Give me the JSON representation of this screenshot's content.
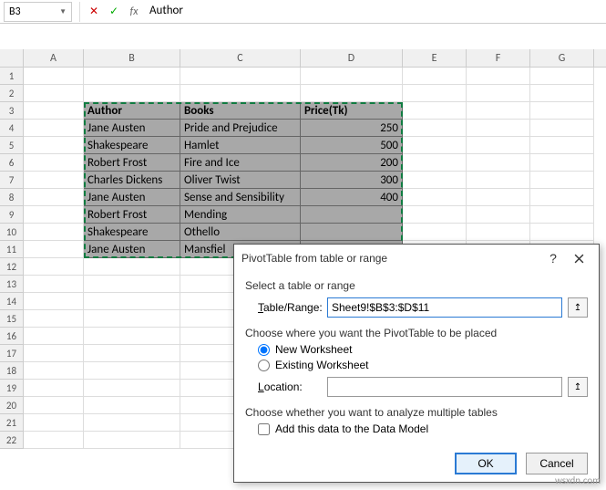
{
  "nameBox": {
    "value": "B3"
  },
  "formulaBar": {
    "value": "Author"
  },
  "cols": [
    "A",
    "B",
    "C",
    "D",
    "E",
    "F",
    "G"
  ],
  "rowCount": 22,
  "table": {
    "headers": {
      "c1": "Author",
      "c2": "Books",
      "c3": "Price(Tk)"
    },
    "rows": [
      {
        "c1": "Jane Austen",
        "c2": "Pride and Prejudice",
        "c3": "250"
      },
      {
        "c1": "Shakespeare",
        "c2": "Hamlet",
        "c3": "500"
      },
      {
        "c1": "Robert Frost",
        "c2": "Fire and Ice",
        "c3": "200"
      },
      {
        "c1": "Charles Dickens",
        "c2": "Oliver Twist",
        "c3": "300"
      },
      {
        "c1": "Jane Austen",
        "c2": "Sense and Sensibility",
        "c3": "400"
      },
      {
        "c1": "Robert Frost",
        "c2": "Mending",
        "c3": ""
      },
      {
        "c1": "Shakespeare",
        "c2": "Othello",
        "c3": ""
      },
      {
        "c1": "Jane Austen",
        "c2": "Mansfiel",
        "c3": ""
      }
    ]
  },
  "dialog": {
    "title": "PivotTable from table or range",
    "sect1": "Select a table or range",
    "rangeLabel": "Table/Range:",
    "rangeValue": "Sheet9!$B$3:$D$11",
    "sect2": "Choose where you want the PivotTable to be placed",
    "opt1": "New Worksheet",
    "opt2": "Existing Worksheet",
    "locLabel": "Location:",
    "locValue": "",
    "sect3": "Choose whether you want to analyze multiple tables",
    "chk": "Add this data to the Data Model",
    "ok": "OK",
    "cancel": "Cancel"
  },
  "watermark": "wsxdn.com"
}
